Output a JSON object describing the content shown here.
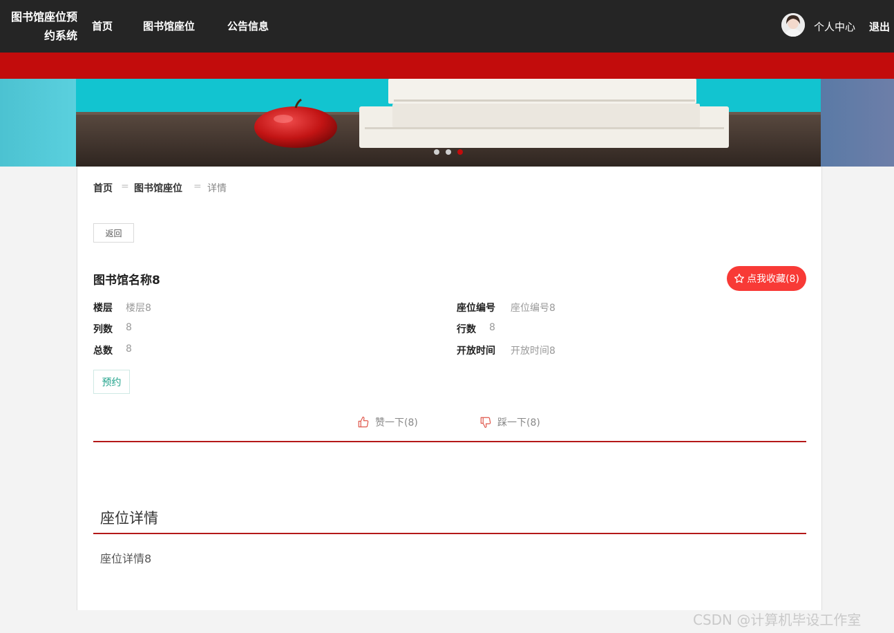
{
  "header": {
    "brand_line1": "图书馆座位预",
    "brand_line2": "约系统",
    "nav": [
      "首页",
      "图书馆座位",
      "公告信息"
    ],
    "profile_label": "个人中心",
    "logout_label": "退出"
  },
  "carousel": {
    "slides": 3,
    "active_index": 2
  },
  "breadcrumb": {
    "home": "首页",
    "section": "图书馆座位",
    "current": "详情",
    "separator": "="
  },
  "detail": {
    "back_label": "返回",
    "name": "图书馆名称8",
    "favorite_label": "点我收藏(8)",
    "fields": [
      {
        "label": "楼层",
        "value": "楼层8"
      },
      {
        "label": "座位编号",
        "value": "座位编号8"
      },
      {
        "label": "列数",
        "value": "8"
      },
      {
        "label": "行数",
        "value": "8"
      },
      {
        "label": "总数",
        "value": "8"
      },
      {
        "label": "开放时间",
        "value": "开放时间8"
      }
    ],
    "reserve_label": "预约",
    "like_label": "赞一下(8)",
    "dislike_label": "踩一下(8)"
  },
  "section": {
    "title": "座位详情",
    "body": "座位详情8"
  },
  "watermark": "CSDN @计算机毕设工作室",
  "colors": {
    "header_bg": "#252525",
    "accent_red": "#c20c0c",
    "favorite_bg": "#f83a36",
    "reserve_green": "#1fa28a"
  }
}
